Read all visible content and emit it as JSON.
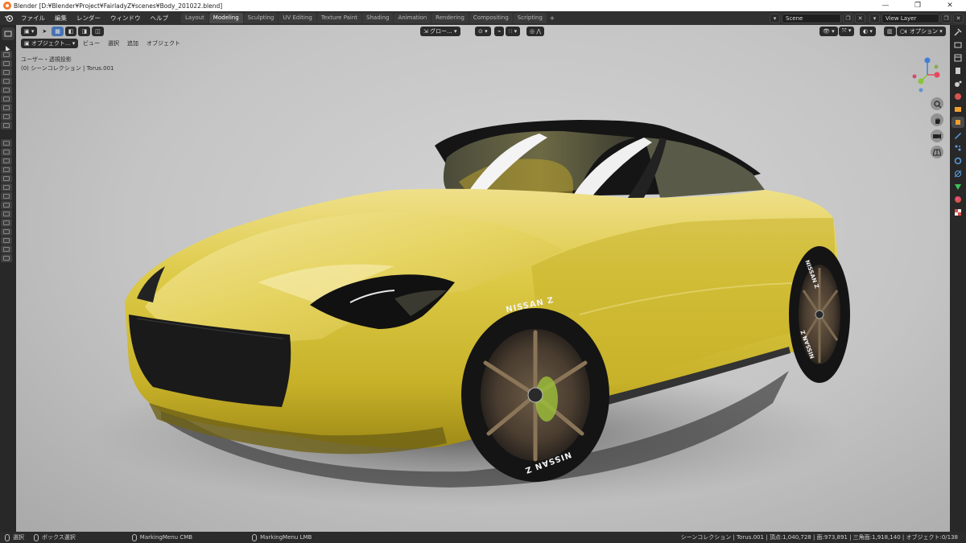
{
  "window": {
    "title": "Blender [D:¥Blender¥Project¥FairladyZ¥scenes¥Body_201022.blend]",
    "minimize": "—",
    "maximize": "❐",
    "close": "✕"
  },
  "menu": {
    "items": [
      "ファイル",
      "編集",
      "レンダー",
      "ウィンドウ",
      "ヘルプ"
    ]
  },
  "workspaces": {
    "tabs": [
      "Layout",
      "Modeling",
      "Sculpting",
      "UV Editing",
      "Texture Paint",
      "Shading",
      "Animation",
      "Rendering",
      "Compositing",
      "Scripting"
    ],
    "active": "Modeling",
    "add": "+"
  },
  "scene": {
    "name": "Scene",
    "view_layer": "View Layer"
  },
  "viewport_header": {
    "mode": "オブジェクト...",
    "menus": [
      "ビュー",
      "選択",
      "追加",
      "オブジェクト"
    ],
    "transform_orientation": "グロー...",
    "options": "オプション"
  },
  "viewport_info": {
    "line1": "ユーザー・透視投影",
    "line2": "(0) シーンコレクション | Torus.001"
  },
  "tire_text": "NISSAN Z",
  "statusbar": {
    "left1": "選択",
    "left2": "ボックス選択",
    "middle1": "MarkingMenu CMB",
    "middle2": "MarkingMenu LMB",
    "stats": "シーンコレクション | Torus.001 | 頂点:1,040,728 | 面:973,891 | 三角面:1,918,140 | オブジェクト:0/138"
  },
  "colors": {
    "car_body": "#d8c43a",
    "selected_blue": "#4772b3",
    "axis_x": "#e8485d",
    "axis_y": "#8ac43a",
    "axis_z": "#3e7fd8"
  }
}
